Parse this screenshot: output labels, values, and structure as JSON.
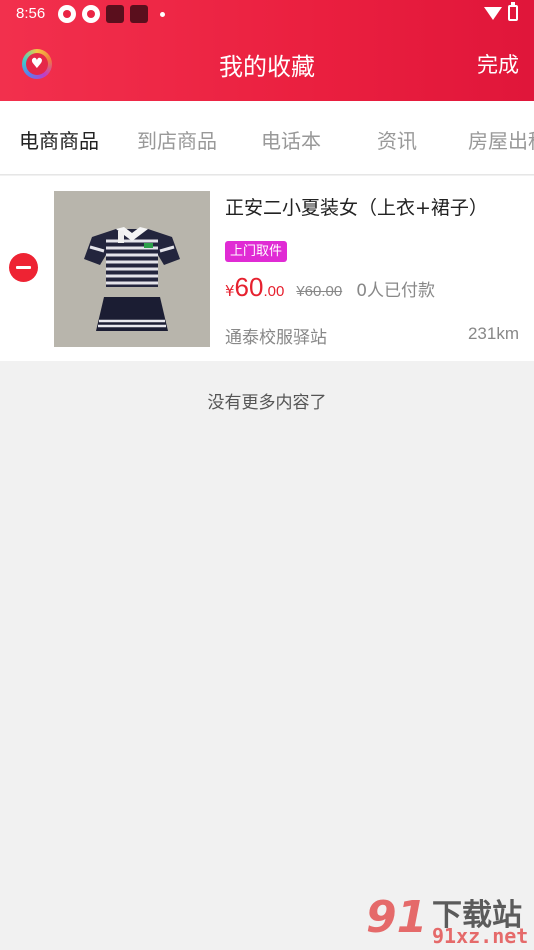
{
  "status_bar": {
    "time": "8:56"
  },
  "header": {
    "title": "我的收藏",
    "done_label": "完成"
  },
  "tabs": [
    {
      "label": "电商商品",
      "active": true
    },
    {
      "label": "到店商品",
      "active": false
    },
    {
      "label": "电话本",
      "active": false
    },
    {
      "label": "资讯",
      "active": false
    },
    {
      "label": "房屋出租",
      "active": false
    }
  ],
  "items": [
    {
      "name": "正安二小夏装女（上衣+裙子）",
      "tag": "上门取件",
      "price_symbol": "¥",
      "price_int": "60",
      "price_dec": ".00",
      "original_price": "¥60.00",
      "paid_count": "0人已付款",
      "shop": "通泰校服驿站",
      "distance": "231km"
    }
  ],
  "footer": {
    "no_more": "没有更多内容了"
  },
  "watermark": {
    "num": "91",
    "cn": "下载站",
    "url": "91xz.net"
  },
  "colors": {
    "header": "#ea1f3f",
    "price": "#e6212f",
    "tag": "#e02bd4",
    "remove": "#ee2333"
  }
}
